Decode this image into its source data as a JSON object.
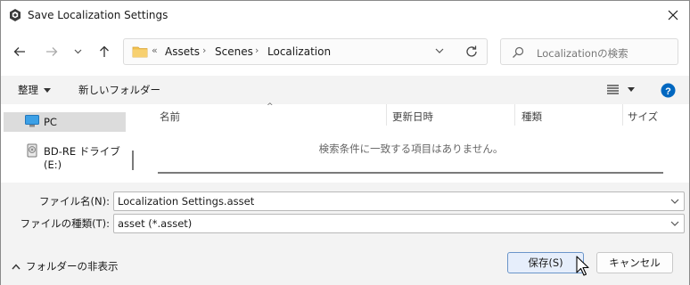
{
  "window": {
    "title": "Save Localization Settings"
  },
  "address": {
    "overflow": "«",
    "crumbs": [
      "Assets",
      "Scenes",
      "Localization"
    ]
  },
  "search": {
    "placeholder": "Localizationの検索"
  },
  "commands": {
    "organize": "整理",
    "new_folder": "新しいフォルダー"
  },
  "nav_pane": {
    "items": [
      {
        "label": "PC",
        "icon": "monitor-icon",
        "selected": true
      },
      {
        "label": "BD-RE ドライブ (E:)",
        "icon": "disc-drive-icon",
        "selected": false
      }
    ]
  },
  "file_list": {
    "columns": [
      "名前",
      "更新日時",
      "種類",
      "サイズ"
    ],
    "empty_message": "検索条件に一致する項目はありません。"
  },
  "form": {
    "filename_label": "ファイル名(N):",
    "filename_value": "Localization Settings.asset",
    "filetype_label": "ファイルの種類(T):",
    "filetype_value": "asset (*.asset)"
  },
  "footer": {
    "hide_folders": "フォルダーの非表示",
    "save_label": "保存(S)",
    "cancel_label": "キャンセル"
  },
  "colors": {
    "accent": "#0067c0",
    "folder": "#f2c14e",
    "selection": "#dcdcdc"
  }
}
